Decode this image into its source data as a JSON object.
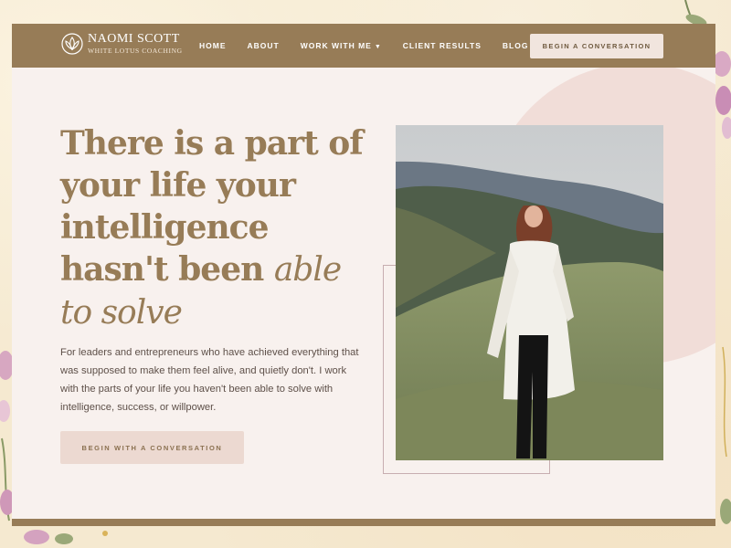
{
  "brand": {
    "name": "NAOMI SCOTT",
    "tagline": "WHITE LOTUS COACHING",
    "logo_icon": "lotus-icon",
    "primary_color": "#977c57",
    "cta_color": "#ecd9d1"
  },
  "nav": {
    "items": [
      {
        "label": "HOME"
      },
      {
        "label": "ABOUT"
      },
      {
        "label": "WORK WITH ME",
        "dropdown": true
      },
      {
        "label": "CLIENT RESULTS"
      },
      {
        "label": "BLOG"
      }
    ],
    "cta_label": "BEGIN A CONVERSATION"
  },
  "hero": {
    "headline_lines": [
      "There is a part of",
      "your life your",
      "intelligence"
    ],
    "headline_partial": "hasn't been",
    "headline_italic_1": "able",
    "headline_italic_2": "to solve",
    "body": "For leaders and entrepreneurs who have achieved everything that was supposed to make them feel alive, and quietly don't. I work with the parts of your life you haven't been able to solve with intelligence, success, or willpower.",
    "cta_label": "BEGIN WITH A CONVERSATION"
  }
}
